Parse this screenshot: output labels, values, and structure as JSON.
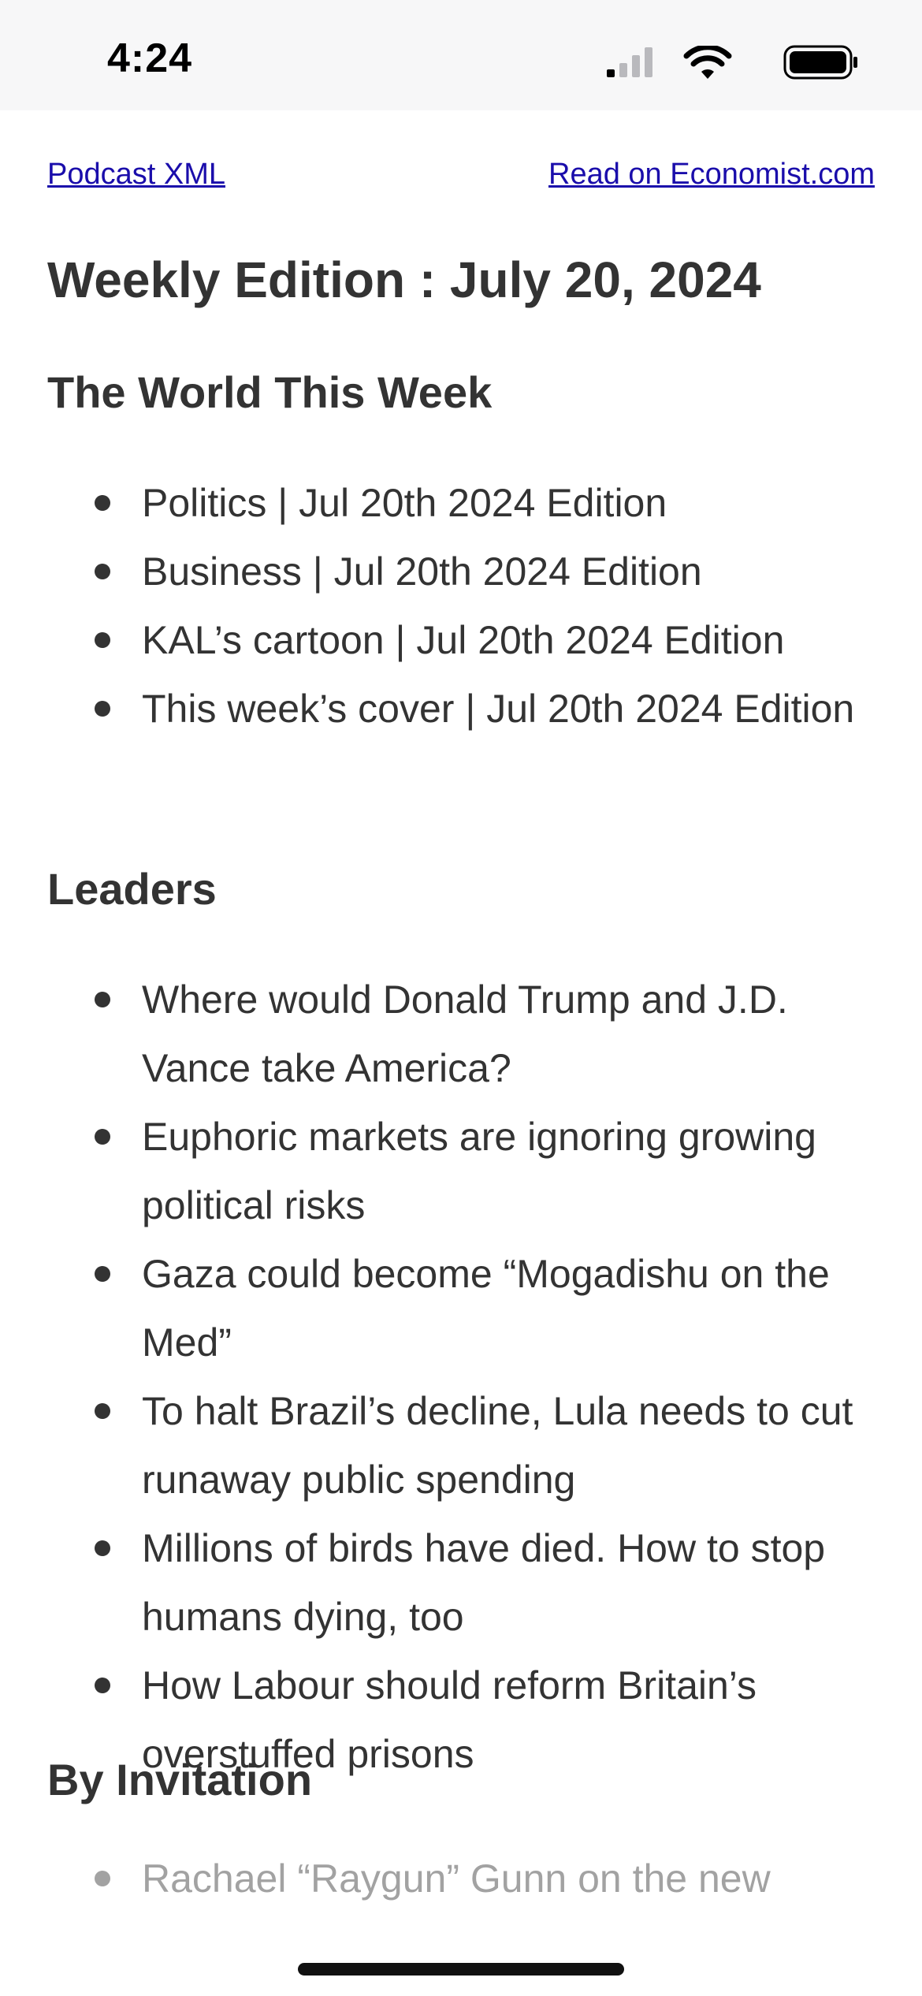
{
  "status_bar": {
    "time": "4:24"
  },
  "top_links": {
    "podcast_xml": "Podcast XML",
    "read_on_economist": "Read on Economist.com"
  },
  "edition_title": "Weekly Edition : July 20, 2024",
  "sections": {
    "world": {
      "heading": "The World This Week",
      "items": [
        "Politics | Jul 20th 2024 Edition",
        "Business | Jul 20th 2024 Edition",
        "KAL’s cartoon | Jul 20th 2024 Edition",
        "This week’s cover | Jul 20th 2024 Edition"
      ]
    },
    "leaders": {
      "heading": "Leaders",
      "items": [
        "Where would Donald Trump and J.D. Vance take America?",
        "Euphoric markets are ignoring growing political risks",
        "Gaza could become “Mogadishu on the Med”",
        "To halt Brazil’s decline, Lula needs to cut runaway public spending",
        "Millions of birds have died. How to stop humans dying, too",
        "How Labour should reform Britain’s overstuffed prisons"
      ]
    },
    "by_invitation": {
      "heading": "By Invitation",
      "items": [
        "Rachael “Raygun” Gunn on the new"
      ]
    }
  },
  "colors": {
    "link": "#1a0dab",
    "text": "#333333",
    "status_bar_bg": "#f7f7f8"
  },
  "icons": [
    "signal-icon",
    "wifi-icon",
    "battery-icon"
  ]
}
